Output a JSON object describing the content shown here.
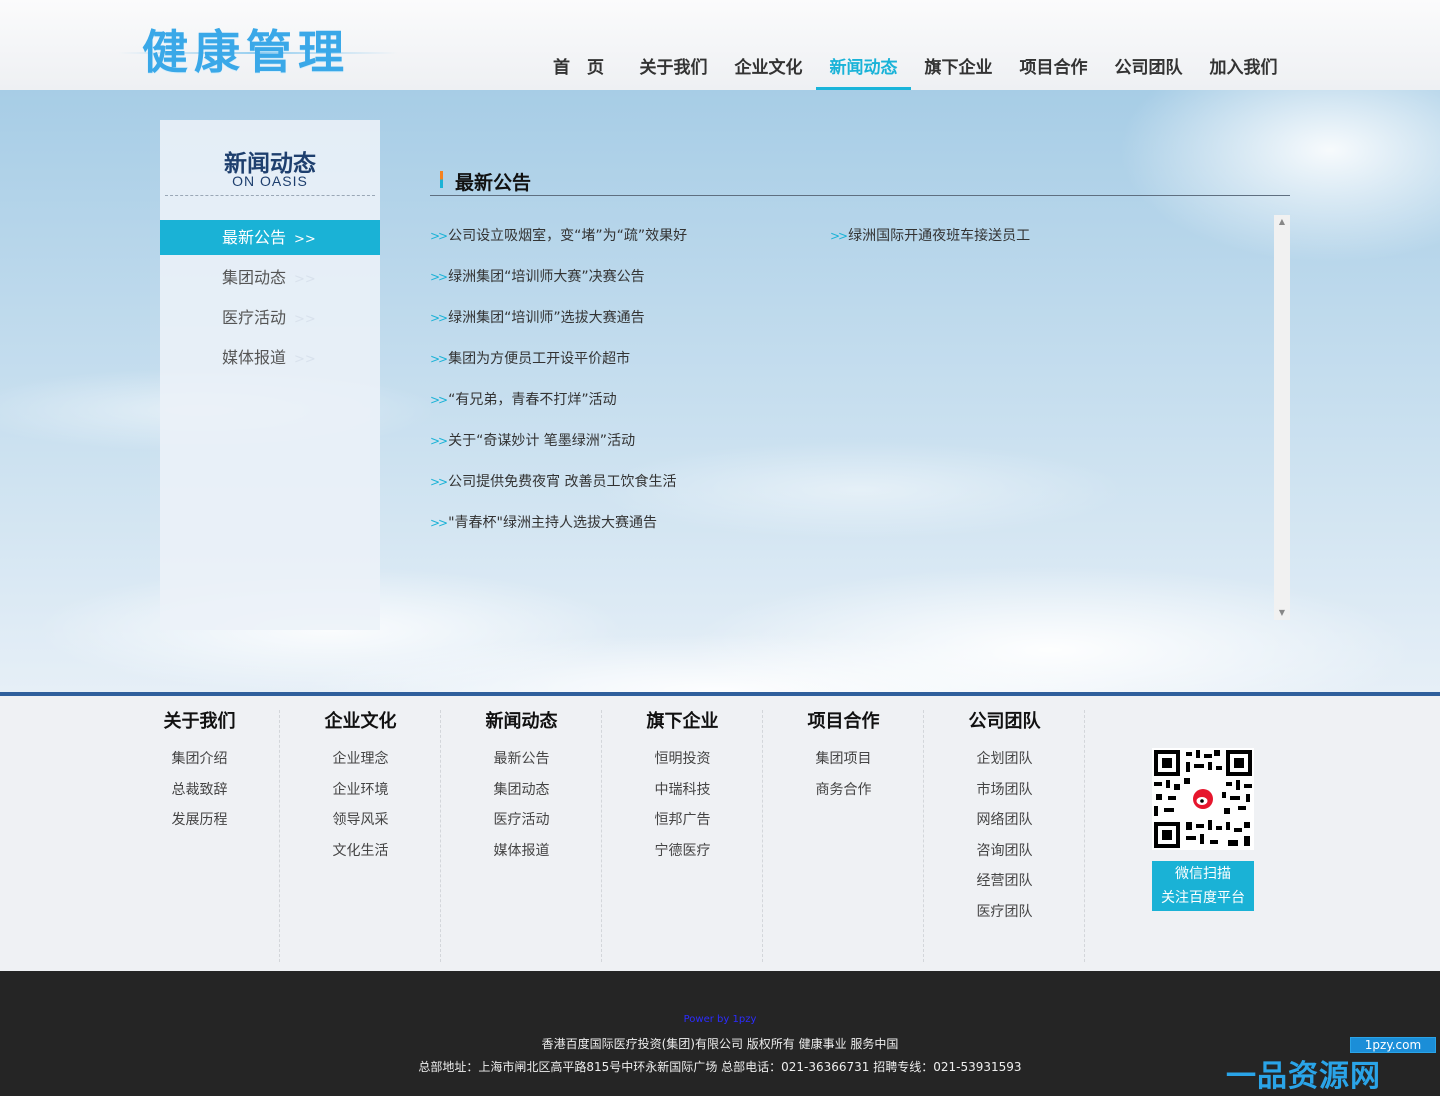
{
  "header": {
    "logo": "健康管理",
    "nav": [
      "首　页",
      "关于我们",
      "企业文化",
      "新闻动态",
      "旗下企业",
      "项目合作",
      "公司团队",
      "加入我们"
    ],
    "active_index": 3
  },
  "sidebar": {
    "title": "新闻动态",
    "subtitle": "ON OASIS",
    "arrows": ">>",
    "items": [
      "最新公告",
      "集团动态",
      "医疗活动",
      "媒体报道"
    ],
    "active_index": 0
  },
  "main": {
    "title": "最新公告",
    "arrow_glyph": ">>",
    "news_left": [
      "公司设立吸烟室，变“堵”为“疏”效果好",
      "绿洲集团“培训师大赛”决赛公告",
      "绿洲集团“培训师”选拔大赛通告",
      "集团为方便员工开设平价超市",
      "“有兄弟，青春不打烊”活动",
      "关于“奇谋妙计 笔墨绿洲”活动",
      "公司提供免费夜宵 改善员工饮食生活",
      "\"青春杯\"绿洲主持人选拔大赛通告"
    ],
    "news_right": [
      "绿洲国际开通夜班车接送员工"
    ]
  },
  "footer": {
    "columns": [
      {
        "title": "关于我们",
        "items": [
          "集团介绍",
          "总裁致辞",
          "发展历程"
        ]
      },
      {
        "title": "企业文化",
        "items": [
          "企业理念",
          "企业环境",
          "领导风采",
          "文化生活"
        ]
      },
      {
        "title": "新闻动态",
        "items": [
          "最新公告",
          "集团动态",
          "医疗活动",
          "媒体报道"
        ]
      },
      {
        "title": "旗下企业",
        "items": [
          "恒明投资",
          "中瑞科技",
          "恒邦广告",
          "宁德医疗"
        ]
      },
      {
        "title": "项目合作",
        "items": [
          "集团项目",
          "商务合作"
        ]
      },
      {
        "title": "公司团队",
        "items": [
          "企划团队",
          "市场团队",
          "网络团队",
          "咨询团队",
          "经营团队",
          "医疗团队"
        ]
      }
    ],
    "qr_line1": "微信扫描",
    "qr_line2": "关注百度平台"
  },
  "bottom": {
    "powered": "Power by 1pzy",
    "copyright": "香港百度国际医疗投资(集团)有限公司 版权所有 健康事业 服务中国",
    "address": "总部地址：上海市闸北区高平路815号中环永新国际广场 总部电话：021-36366731 招聘专线：021-53931593",
    "watermark_url": "1pzy.com",
    "watermark_text": "一品资源网"
  },
  "colors": {
    "accent": "#1ab2d6",
    "navy": "#1e3f6e",
    "border_blue": "#2f5f9c",
    "footer_dark": "#252525"
  },
  "icons": [
    "qr-code-icon",
    "weibo-icon",
    "scroll-up-arrow-icon",
    "scroll-down-arrow-icon"
  ]
}
